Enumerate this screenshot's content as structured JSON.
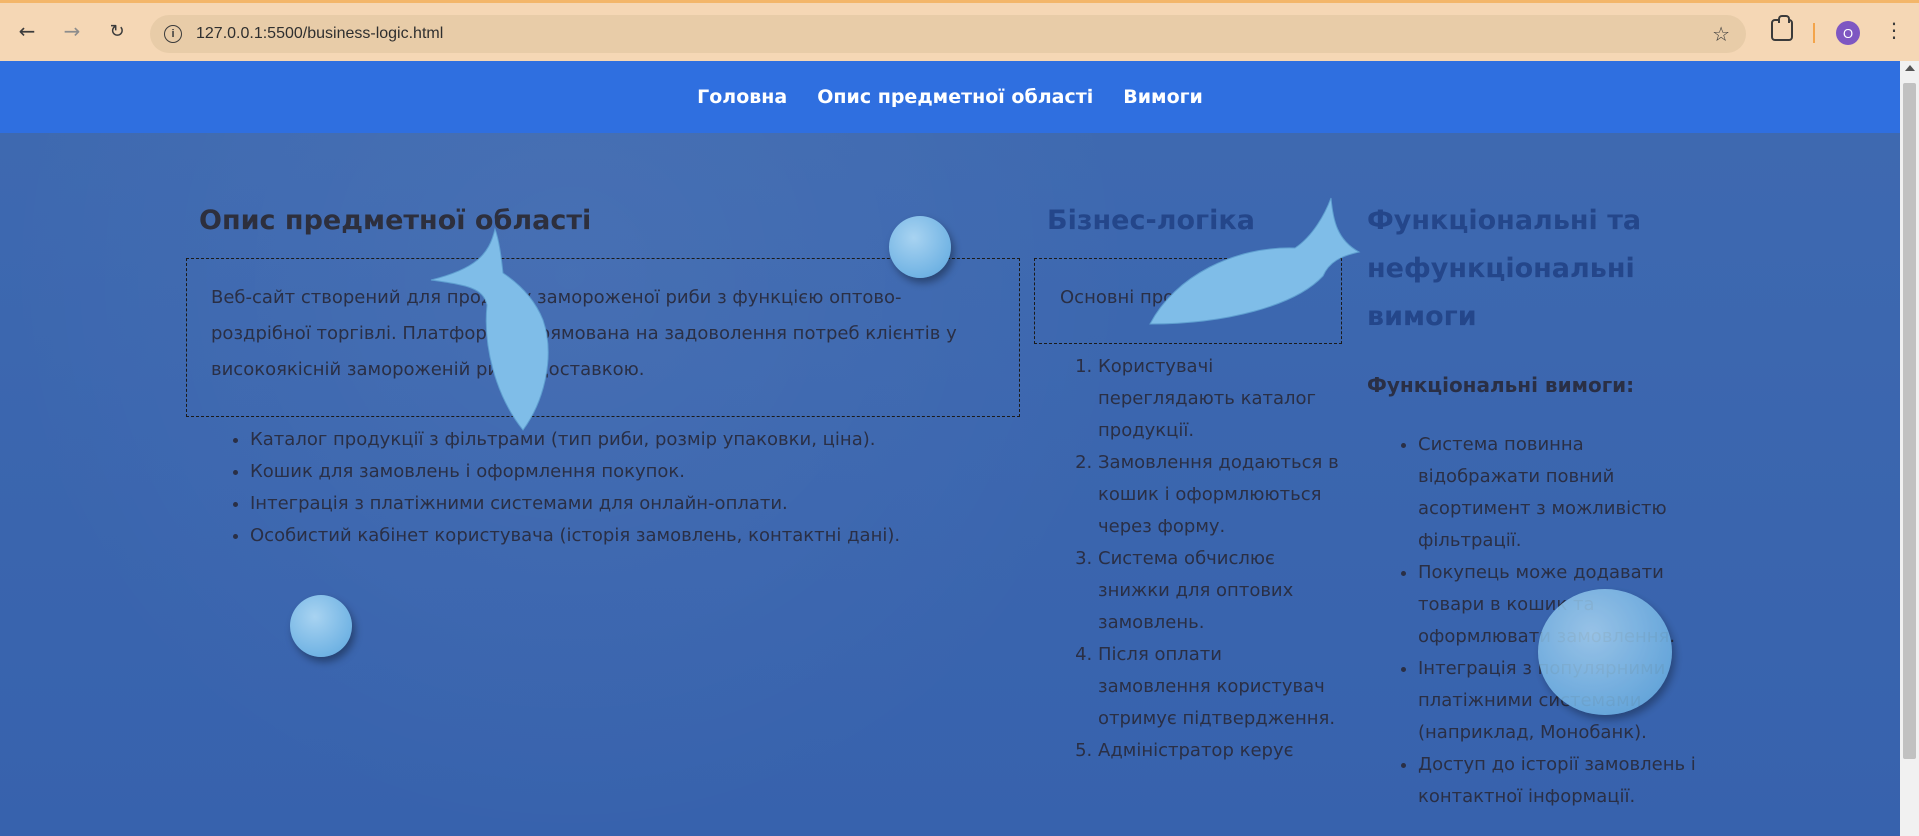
{
  "browser": {
    "url": "127.0.0.1:5500/business-logic.html",
    "profile_initial": "O",
    "accent": "#f3b66a"
  },
  "nav": {
    "links": [
      "Головна",
      "Опис предметної області",
      "Вимоги"
    ]
  },
  "domain_section": {
    "title": "Опис предметної області",
    "description": "Веб-сайт створений для продажу замороженої риби з функцією оптово-роздрібної торгівлі. Платформа спрямована на задоволення потреб клієнтів у високоякісній замороженій рибі з доставкою.",
    "features": [
      "Каталог продукції з фільтрами (тип риби, розмір упаковки, ціна).",
      "Кошик для замовлень і оформлення покупок.",
      "Інтеграція з платіжними системами для онлайн-оплати.",
      "Особистий кабінет користувача (історія замовлень, контактні дані)."
    ]
  },
  "business_section": {
    "title": "Бізнес-логіка",
    "intro": "Основні процеси:",
    "steps": [
      "Користувачі переглядають каталог продукції.",
      "Замовлення додаються в кошик і оформлюються через форму.",
      "Система обчислює знижки для оптових замовлень.",
      "Після оплати замовлення користувач отримує підтвердження.",
      "Адміністратор керує"
    ]
  },
  "requirements_section": {
    "title": "Функціональні та нефункціональні вимоги",
    "functional_title": "Функціональні вимоги:",
    "functional": [
      "Система повинна відображати повний асортимент з можливістю фільтрації.",
      "Покупець може додавати товари в кошик та оформлювати замовлення.",
      "Інтеграція з популярними платіжними системами (наприклад, Монобанк).",
      "Доступ до історії замовлень і контактної інформації."
    ]
  },
  "colors": {
    "nav_bar": "#2f6fe0",
    "background": "#3a67b3",
    "accent_heading": "#24468a"
  }
}
